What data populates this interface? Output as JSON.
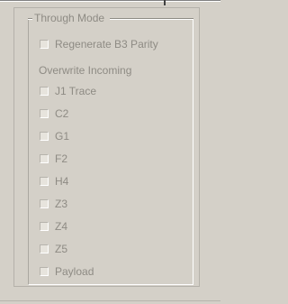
{
  "group": {
    "title": "Through Mode"
  },
  "through_mode": {
    "regenerate_b3_parity": {
      "label": "Regenerate B3 Parity",
      "checked": false,
      "enabled": false
    }
  },
  "overwrite_incoming": {
    "label": "Overwrite Incoming",
    "items": [
      {
        "label": "J1 Trace",
        "checked": false,
        "enabled": false
      },
      {
        "label": "C2",
        "checked": false,
        "enabled": false
      },
      {
        "label": "G1",
        "checked": false,
        "enabled": false
      },
      {
        "label": "F2",
        "checked": false,
        "enabled": false
      },
      {
        "label": "H4",
        "checked": false,
        "enabled": false
      },
      {
        "label": "Z3",
        "checked": false,
        "enabled": false
      },
      {
        "label": "Z4",
        "checked": false,
        "enabled": false
      },
      {
        "label": "Z5",
        "checked": false,
        "enabled": false
      },
      {
        "label": "Payload",
        "checked": false,
        "enabled": false
      }
    ]
  },
  "colors": {
    "background": "#d4d0c8",
    "disabled_text": "#8e8b84",
    "checkbox_fill": "#e7e4dd"
  }
}
